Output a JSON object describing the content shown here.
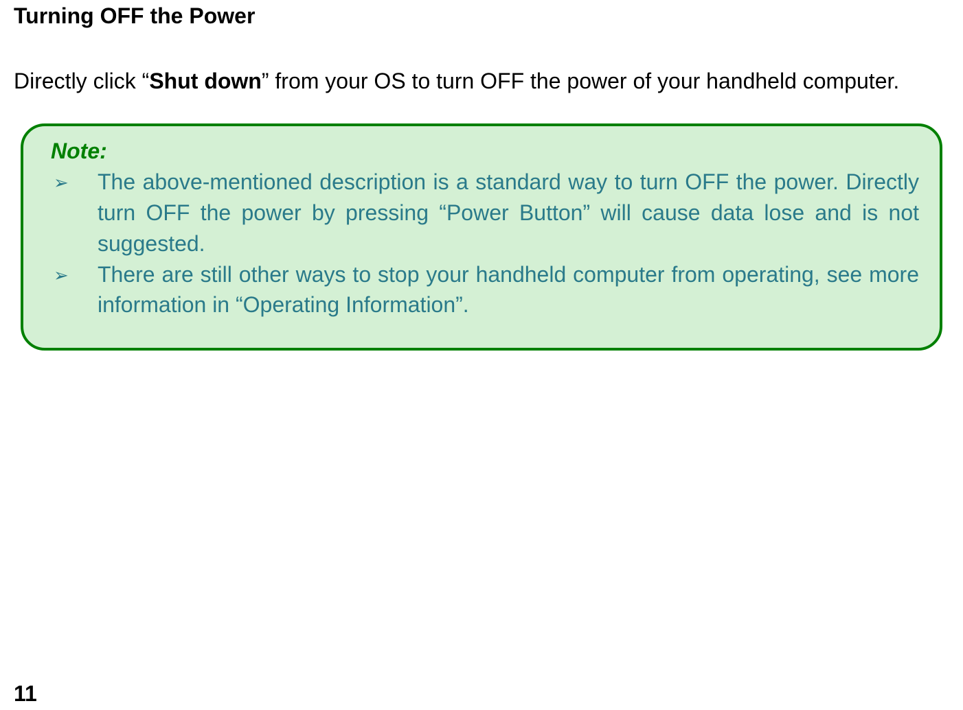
{
  "heading": "Turning OFF the Power",
  "intro": {
    "prefix": "Directly click “",
    "bold": "Shut down",
    "suffix": "” from your OS to turn OFF the power of your handheld computer."
  },
  "note": {
    "title": "Note:",
    "bullet": "➢",
    "items": [
      "The above-mentioned description is a standard way to turn OFF the power. Directly turn OFF the power by pressing “Power Button” will cause data lose and is not suggested.",
      "There are still other ways to stop your handheld computer from operating, see more information in “Operating Information”."
    ]
  },
  "page_number": "11"
}
